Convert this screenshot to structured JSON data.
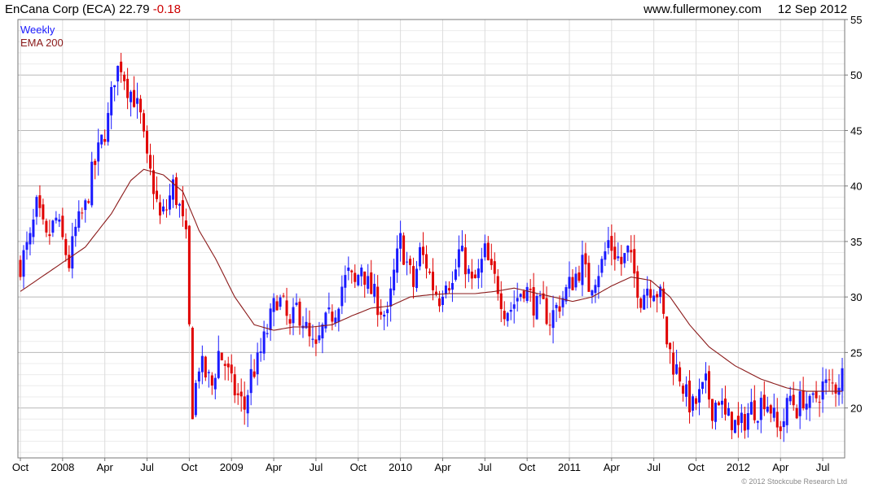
{
  "header": {
    "name": "EnCana Corp (ECA)",
    "price": "22.79",
    "change": "-0.18",
    "site": "www.fullermoney.com",
    "date": "12 Sep 2012"
  },
  "legend": {
    "series1": "Weekly",
    "series2": "EMA 200"
  },
  "copyright": "© 2012 Stockcube Research Ltd",
  "colors": {
    "up": "#1a1aff",
    "down": "#e00000",
    "ema": "#8b1a1a",
    "grid": "#d0d0d0"
  },
  "chart_data": {
    "type": "candlestick",
    "y_ticks": [
      20,
      25,
      30,
      35,
      40,
      45,
      50,
      55
    ],
    "ylim": [
      15.5,
      55
    ],
    "y_axis_side": "right",
    "x_range": [
      0,
      200
    ],
    "x_ticks": [
      {
        "label": "Oct",
        "week": 0
      },
      {
        "label": "2008",
        "week": 13
      },
      {
        "label": "Apr",
        "week": 26
      },
      {
        "label": "Jul",
        "week": 39
      },
      {
        "label": "Oct",
        "week": 52
      },
      {
        "label": "2009",
        "week": 65
      },
      {
        "label": "Apr",
        "week": 78
      },
      {
        "label": "Jul",
        "week": 91
      },
      {
        "label": "Oct",
        "week": 104
      },
      {
        "label": "2010",
        "week": 117
      },
      {
        "label": "Apr",
        "week": 130
      },
      {
        "label": "Jul",
        "week": 143
      },
      {
        "label": "Oct",
        "week": 156
      },
      {
        "label": "2011",
        "week": 169
      },
      {
        "label": "Apr",
        "week": 182
      },
      {
        "label": "Jul",
        "week": 195
      },
      {
        "label": "Oct",
        "week": 208
      },
      {
        "label": "2012",
        "week": 221
      },
      {
        "label": "Apr",
        "week": 234
      },
      {
        "label": "Jul",
        "week": 247
      }
    ],
    "grid": true,
    "weekly_close_keypoints": [
      [
        0,
        33
      ],
      [
        3,
        35
      ],
      [
        5,
        38
      ],
      [
        8,
        35
      ],
      [
        11,
        37
      ],
      [
        15,
        33
      ],
      [
        17,
        36
      ],
      [
        20,
        38
      ],
      [
        22,
        41
      ],
      [
        25,
        44
      ],
      [
        27,
        46
      ],
      [
        29,
        50
      ],
      [
        31,
        51
      ],
      [
        33,
        49
      ],
      [
        35,
        48
      ],
      [
        37,
        46
      ],
      [
        39,
        42
      ],
      [
        41,
        40
      ],
      [
        43,
        37
      ],
      [
        45,
        38
      ],
      [
        47,
        40
      ],
      [
        49,
        38
      ],
      [
        51,
        35
      ],
      [
        52,
        27
      ],
      [
        53,
        20
      ],
      [
        55,
        24
      ],
      [
        57,
        23
      ],
      [
        59,
        22
      ],
      [
        61,
        25
      ],
      [
        63,
        24
      ],
      [
        65,
        22
      ],
      [
        67,
        21
      ],
      [
        69,
        20
      ],
      [
        71,
        23
      ],
      [
        73,
        24
      ],
      [
        75,
        26
      ],
      [
        77,
        28
      ],
      [
        79,
        30
      ],
      [
        81,
        29
      ],
      [
        83,
        27
      ],
      [
        85,
        29
      ],
      [
        87,
        28
      ],
      [
        89,
        26
      ],
      [
        91,
        25
      ],
      [
        93,
        27
      ],
      [
        95,
        28
      ],
      [
        97,
        29
      ],
      [
        99,
        31
      ],
      [
        101,
        32
      ],
      [
        103,
        31
      ],
      [
        105,
        33
      ],
      [
        107,
        31
      ],
      [
        109,
        30
      ],
      [
        111,
        29
      ],
      [
        113,
        28
      ],
      [
        115,
        32
      ],
      [
        117,
        35
      ],
      [
        119,
        33
      ],
      [
        121,
        31
      ],
      [
        123,
        34
      ],
      [
        125,
        33
      ],
      [
        127,
        31
      ],
      [
        129,
        30
      ],
      [
        131,
        32
      ],
      [
        133,
        31
      ],
      [
        135,
        34
      ],
      [
        137,
        33
      ],
      [
        139,
        31
      ],
      [
        141,
        32
      ],
      [
        143,
        34
      ],
      [
        145,
        32
      ],
      [
        147,
        31
      ],
      [
        149,
        29
      ],
      [
        151,
        29
      ],
      [
        153,
        30
      ],
      [
        155,
        31
      ],
      [
        157,
        30
      ],
      [
        159,
        29
      ],
      [
        161,
        29
      ],
      [
        163,
        28
      ],
      [
        165,
        29
      ],
      [
        167,
        30
      ],
      [
        169,
        31
      ],
      [
        171,
        32
      ],
      [
        173,
        33
      ],
      [
        175,
        31
      ],
      [
        177,
        32
      ],
      [
        179,
        33
      ],
      [
        181,
        35
      ],
      [
        183,
        34
      ],
      [
        185,
        33
      ],
      [
        187,
        34
      ],
      [
        189,
        32
      ],
      [
        191,
        30
      ],
      [
        193,
        31
      ],
      [
        195,
        31
      ],
      [
        197,
        30
      ],
      [
        199,
        26
      ],
      [
        201,
        24
      ],
      [
        203,
        23
      ],
      [
        205,
        21
      ],
      [
        207,
        20
      ],
      [
        209,
        21
      ],
      [
        211,
        22
      ],
      [
        213,
        20
      ],
      [
        215,
        21
      ],
      [
        217,
        19
      ],
      [
        219,
        19
      ],
      [
        221,
        18
      ],
      [
        223,
        19
      ],
      [
        225,
        20
      ],
      [
        227,
        20
      ],
      [
        229,
        21
      ],
      [
        231,
        20
      ],
      [
        233,
        18
      ],
      [
        235,
        19
      ],
      [
        237,
        21
      ],
      [
        239,
        20
      ],
      [
        241,
        21
      ],
      [
        243,
        20
      ],
      [
        245,
        21
      ],
      [
        247,
        22
      ],
      [
        249,
        22
      ],
      [
        251,
        22
      ],
      [
        253,
        23
      ]
    ],
    "ema_200_keypoints": [
      [
        0,
        30.5
      ],
      [
        10,
        32.5
      ],
      [
        20,
        34.5
      ],
      [
        28,
        37.5
      ],
      [
        34,
        40.5
      ],
      [
        38,
        41.5
      ],
      [
        44,
        41
      ],
      [
        50,
        39.5
      ],
      [
        55,
        36
      ],
      [
        60,
        33.5
      ],
      [
        66,
        30
      ],
      [
        72,
        27.5
      ],
      [
        78,
        27
      ],
      [
        84,
        27.3
      ],
      [
        90,
        27.3
      ],
      [
        96,
        27.5
      ],
      [
        102,
        28.3
      ],
      [
        108,
        29
      ],
      [
        114,
        29.2
      ],
      [
        120,
        30
      ],
      [
        126,
        30.2
      ],
      [
        132,
        30.3
      ],
      [
        140,
        30.3
      ],
      [
        146,
        30.5
      ],
      [
        152,
        30.8
      ],
      [
        158,
        30.4
      ],
      [
        164,
        30
      ],
      [
        170,
        29.6
      ],
      [
        176,
        30
      ],
      [
        182,
        31
      ],
      [
        188,
        31.8
      ],
      [
        194,
        31.5
      ],
      [
        200,
        30
      ],
      [
        206,
        27.5
      ],
      [
        212,
        25.5
      ],
      [
        220,
        23.8
      ],
      [
        228,
        22.6
      ],
      [
        236,
        21.8
      ],
      [
        242,
        21.5
      ],
      [
        248,
        21.5
      ],
      [
        254,
        21.5
      ]
    ]
  }
}
